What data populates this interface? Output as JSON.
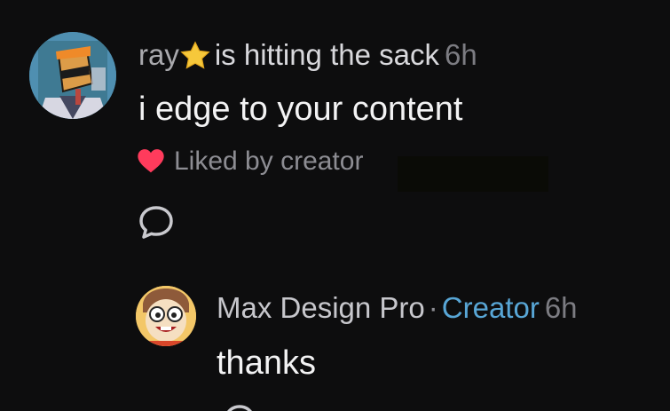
{
  "comment": {
    "username": "ray",
    "username_icon": "star-icon",
    "status_text": "is hitting the sack",
    "time": "6h",
    "body": "i edge to your content",
    "liked_icon": "heart-icon",
    "liked_text": "Liked by creator",
    "reply_icon": "reply-icon"
  },
  "reply": {
    "name": "Max Design Pro",
    "separator": "·",
    "role": "Creator",
    "time": "6h",
    "body": "thanks"
  },
  "colors": {
    "background": "#0d0d0e",
    "creator_accent": "#58a6d6",
    "heart": "#ff3b5c",
    "star": "#f6c83b"
  }
}
